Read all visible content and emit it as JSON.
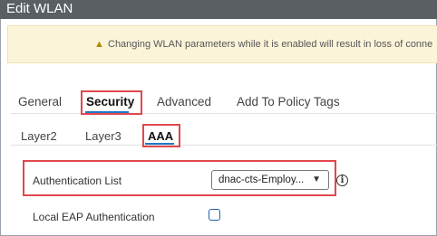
{
  "window": {
    "title": "Edit WLAN"
  },
  "warning": {
    "icon": "warning-icon",
    "text": "Changing WLAN parameters while it is enabled will result in loss of conne"
  },
  "tabs": [
    {
      "label": "General",
      "active": false
    },
    {
      "label": "Security",
      "active": true
    },
    {
      "label": "Advanced",
      "active": false
    },
    {
      "label": "Add To Policy Tags",
      "active": false
    }
  ],
  "subtabs": [
    {
      "label": "Layer2",
      "active": false
    },
    {
      "label": "Layer3",
      "active": false
    },
    {
      "label": "AAA",
      "active": true
    }
  ],
  "form": {
    "auth_list": {
      "label": "Authentication List",
      "value": "dnac-cts-Employ...",
      "info_icon": "info-icon"
    },
    "local_eap": {
      "label": "Local EAP Authentication",
      "checked": false
    }
  },
  "colors": {
    "accent": "#1f77c8",
    "highlight": "#e0484d",
    "header": "#5a5f63",
    "warning_bg": "#fcf4d9"
  }
}
